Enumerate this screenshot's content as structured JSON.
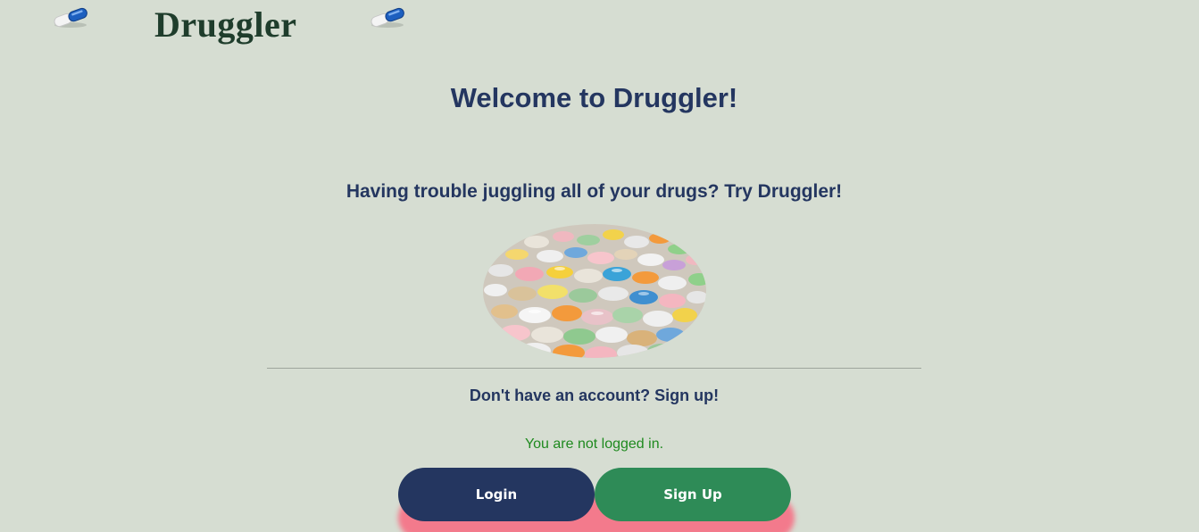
{
  "header": {
    "brand": "Druggler",
    "left_icon": "pill-capsule-icon",
    "right_icon": "pill-capsule-icon"
  },
  "main": {
    "welcome": "Welcome to Druggler!",
    "tagline": "Having trouble juggling all of your drugs? Try Druggler!",
    "hero_image": "pills-pile-image",
    "signup_prompt": "Don't have an account? Sign up!",
    "status": "You are not logged in."
  },
  "buttons": {
    "login": "Login",
    "signup": "Sign Up"
  },
  "colors": {
    "background": "#d6ddd2",
    "primary_navy": "#243660",
    "brand_green": "#1f3d2c",
    "signup_green": "#2e8b57",
    "status_green": "#1f8a1f",
    "button_glow": "#f37a8c"
  }
}
